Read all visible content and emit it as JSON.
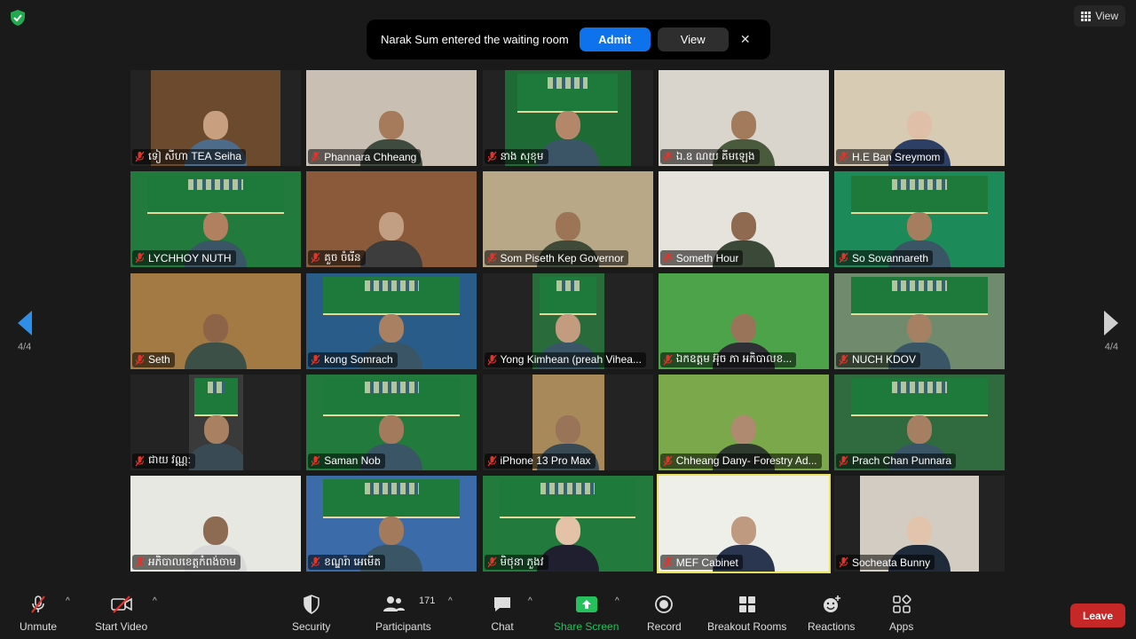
{
  "top": {
    "view_label": "View"
  },
  "notification": {
    "text": "Narak Sum entered the waiting room",
    "admit_label": "Admit",
    "view_label": "View",
    "close_glyph": "✕"
  },
  "paging": {
    "left_label": "4/4",
    "right_label": "4/4"
  },
  "colors": {
    "accent_blue": "#0e72ed",
    "leave_red": "#c62828",
    "share_green": "#25c15c",
    "active_speaker": "#e8e35a"
  },
  "participants": [
    {
      "name": "ទៀ សីហា TEA Seiha",
      "bg": "#6b4a2e",
      "vid_w": 0.76,
      "banner": false,
      "skin": "#c9a07f",
      "suit": "#4d6b8a"
    },
    {
      "name": "Phannara Chheang",
      "bg": "#c9bfb3",
      "vid_w": 1.0,
      "banner": false,
      "skin": "#a67b5b",
      "suit": "#3f4b3f"
    },
    {
      "name": "នាង សុខុម",
      "bg": "#1f6b36",
      "vid_w": 0.74,
      "banner": true,
      "skin": "#b5876a",
      "suit": "#3b5566"
    },
    {
      "name": "ឯ.ឧ ណយ គីមឡេង",
      "bg": "#d9d4cc",
      "vid_w": 1.0,
      "banner": false,
      "skin": "#a27a5c",
      "suit": "#4a5a3c"
    },
    {
      "name": "H.E Ban Sreymom",
      "bg": "#d8cbb4",
      "vid_w": 1.0,
      "banner": false,
      "skin": "#e0bfa8",
      "suit": "#2e3f66"
    },
    {
      "name": "LYCHHOY NUTH",
      "bg": "#227a3c",
      "vid_w": 1.0,
      "banner": true,
      "skin": "#b08060",
      "suit": "#3a5566"
    },
    {
      "name": "គួច ចំរើន",
      "bg": "#8a5a3a",
      "vid_w": 1.0,
      "banner": false,
      "skin": "#c29e82",
      "suit": "#3d3d3d"
    },
    {
      "name": "Som Piseth Kep Governor",
      "bg": "#b8a888",
      "vid_w": 1.0,
      "banner": false,
      "skin": "#9c7456",
      "suit": "#3f4a38"
    },
    {
      "name": "Someth Hour",
      "bg": "#e6e2dc",
      "vid_w": 1.0,
      "banner": false,
      "skin": "#8f6a50",
      "suit": "#3b4a38"
    },
    {
      "name": "So Sovannareth",
      "bg": "#1d8a5a",
      "vid_w": 1.0,
      "banner": true,
      "skin": "#a77d60",
      "suit": "#3a5566"
    },
    {
      "name": "Seth",
      "bg": "#a47a44",
      "vid_w": 1.0,
      "banner": false,
      "skin": "#8d6448",
      "suit": "#3d5048"
    },
    {
      "name": "kong Somrach",
      "bg": "#2a5c8a",
      "vid_w": 1.0,
      "banner": true,
      "skin": "#a98062",
      "suit": "#3a5566"
    },
    {
      "name": "Yong Kimhean (preah Vihea...",
      "bg": "#2a6b3c",
      "vid_w": 0.42,
      "banner": true,
      "skin": "#c39c80",
      "suit": "#3a5566"
    },
    {
      "name": "ឯកឧត្តម អ៊ុច ភា អភិបាលខ...",
      "bg": "#4da34a",
      "vid_w": 1.0,
      "banner": false,
      "skin": "#9a7458",
      "suit": "#2f2f36"
    },
    {
      "name": "NUCH KDOV",
      "bg": "#6f8a6c",
      "vid_w": 1.0,
      "banner": true,
      "skin": "#a58062",
      "suit": "#3a5566"
    },
    {
      "name": "ជាយ វណ្ណ:",
      "bg": "#3a3a3a",
      "vid_w": 0.32,
      "banner": true,
      "skin": "#a98062",
      "suit": "#3a4a55"
    },
    {
      "name": "Saman Nob",
      "bg": "#227a3c",
      "vid_w": 1.0,
      "banner": true,
      "skin": "#a47a5c",
      "suit": "#3a5566"
    },
    {
      "name": "iPhone 13 Pro Max",
      "bg": "#a88a5a",
      "vid_w": 0.42,
      "banner": false,
      "skin": "#9a7458",
      "suit": "#3a4a55"
    },
    {
      "name": "Chheang Dany- Forestry Ad...",
      "bg": "#7ba84a",
      "vid_w": 1.0,
      "banner": false,
      "skin": "#b08a70",
      "suit": "#2f3a2f"
    },
    {
      "name": "Prach Chan Punnara",
      "bg": "#2f6b3e",
      "vid_w": 1.0,
      "banner": true,
      "skin": "#a67e62",
      "suit": "#3a5566"
    },
    {
      "name": "អភិបាលខេត្តកំពង់ចាម",
      "bg": "#e8e8e2",
      "vid_w": 1.0,
      "banner": false,
      "skin": "#8d6a52",
      "suit": "#d9d9d9"
    },
    {
      "name": "ខណ្ឌរ៉ា អេមើត",
      "bg": "#3b6ba8",
      "vid_w": 1.0,
      "banner": true,
      "skin": "#a47a5c",
      "suit": "#3a5566"
    },
    {
      "name": "មិថុនា ភួងវ",
      "bg": "#227a3c",
      "vid_w": 1.0,
      "banner": true,
      "skin": "#e3c2a8",
      "suit": "#1f1f2f"
    },
    {
      "name": "MEF Cabinet",
      "bg": "#efefea",
      "vid_w": 1.0,
      "banner": false,
      "skin": "#c09a80",
      "suit": "#2a3550",
      "active": true
    },
    {
      "name": "Socheata Bunny",
      "bg": "#d2ccc2",
      "vid_w": 0.7,
      "banner": false,
      "skin": "#e2c3ab",
      "suit": "#1f2a3a"
    }
  ],
  "toolbar": {
    "unmute": "Unmute",
    "start_video": "Start Video",
    "security": "Security",
    "participants": "Participants",
    "participant_count": "171",
    "chat": "Chat",
    "share_screen": "Share Screen",
    "record": "Record",
    "breakout_rooms": "Breakout Rooms",
    "reactions": "Reactions",
    "apps": "Apps",
    "leave": "Leave"
  }
}
